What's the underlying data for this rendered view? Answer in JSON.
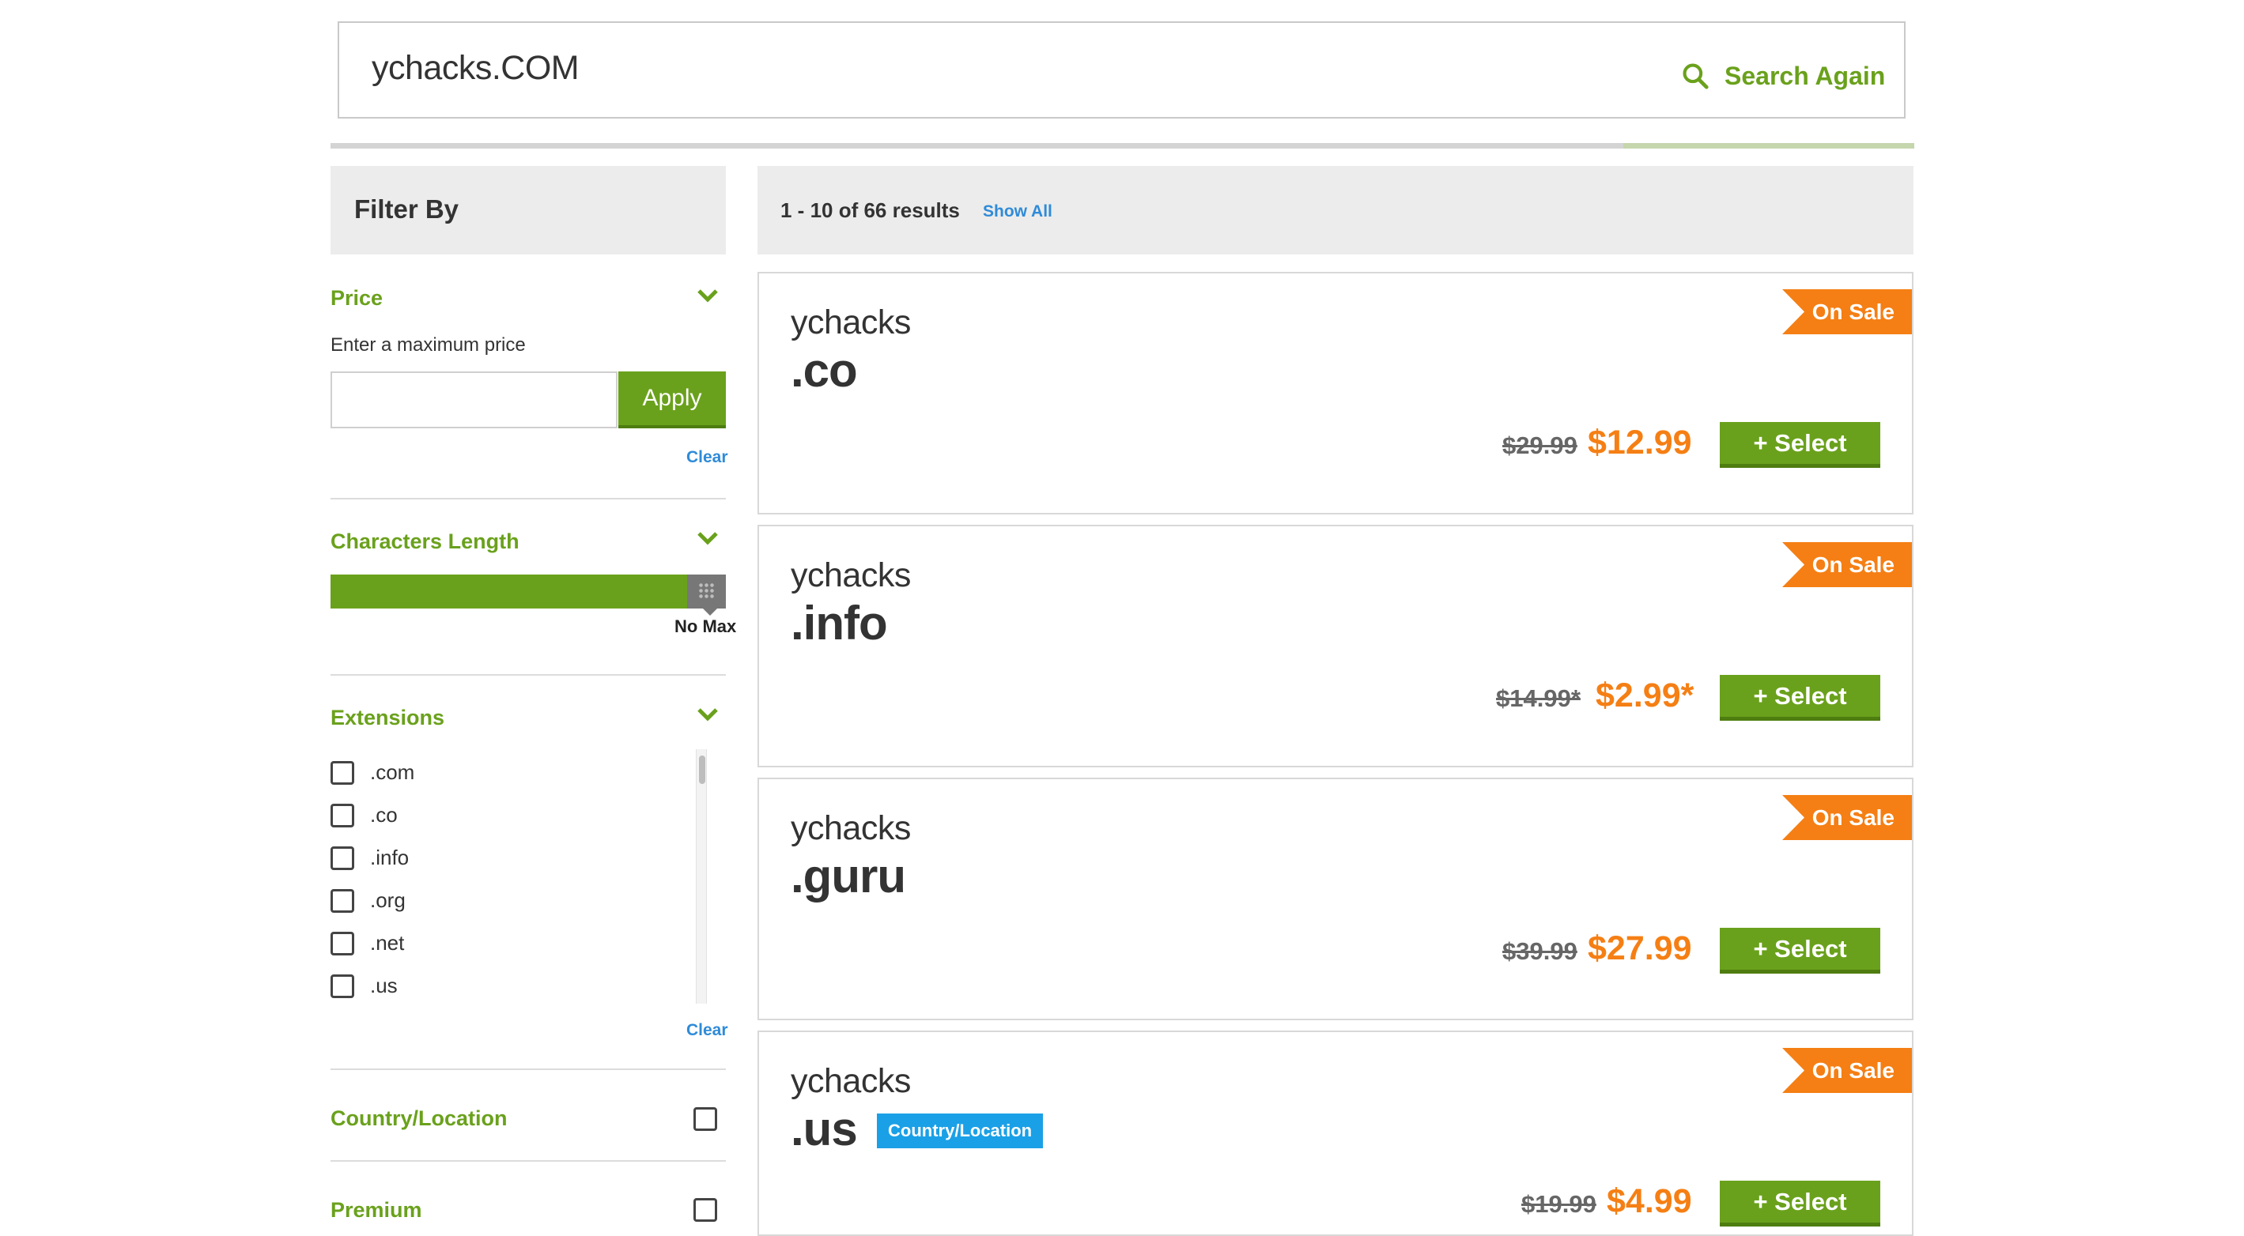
{
  "search": {
    "value": "ychacks.COM",
    "button_label": "Search Again"
  },
  "filter": {
    "title": "Filter By",
    "price": {
      "title": "Price",
      "hint": "Enter a maximum price",
      "input_value": "",
      "apply_label": "Apply",
      "clear_label": "Clear"
    },
    "length": {
      "title": "Characters Length",
      "slider_label": "No Max",
      "slider_value_fraction": 1.0
    },
    "extensions": {
      "title": "Extensions",
      "items": [
        ".com",
        ".co",
        ".info",
        ".org",
        ".net",
        ".us"
      ],
      "clear_label": "Clear"
    },
    "country": {
      "title": "Country/Location"
    },
    "premium": {
      "title": "Premium"
    }
  },
  "results": {
    "count_text": "1 - 10 of 66 results",
    "show_all_label": "Show All",
    "items": [
      {
        "name": "ychacks",
        "ext": ".co",
        "badge": "On Sale",
        "old_price": "$29.99",
        "new_price": "$12.99",
        "select_label": "+ Select",
        "tag": ""
      },
      {
        "name": "ychacks",
        "ext": ".info",
        "badge": "On Sale",
        "old_price": "$14.99*",
        "new_price": "$2.99*",
        "select_label": "+ Select",
        "tag": ""
      },
      {
        "name": "ychacks",
        "ext": ".guru",
        "badge": "On Sale",
        "old_price": "$39.99",
        "new_price": "$27.99",
        "select_label": "+ Select",
        "tag": ""
      },
      {
        "name": "ychacks",
        "ext": ".us",
        "badge": "On Sale",
        "old_price": "$19.99",
        "new_price": "$4.99",
        "select_label": "+ Select",
        "tag": "Country/Location"
      }
    ]
  },
  "colors": {
    "accent_green": "#6aa11c",
    "sale_orange": "#f57f14",
    "link_blue": "#2f8bd8",
    "tag_blue": "#1aa0e6"
  },
  "icons": {
    "search": "search-icon",
    "chevron": "chevron-down-icon",
    "slider": "grip-icon"
  }
}
